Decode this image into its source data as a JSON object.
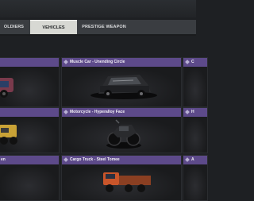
{
  "tabs": [
    {
      "label": "OLDIERS"
    },
    {
      "label": "VEHICLES"
    },
    {
      "label": "PRESTIGE WEAPON"
    }
  ],
  "cards": {
    "r1c1": {
      "title": ""
    },
    "r1c2": {
      "title": "Muscle Car - Unending Circle"
    },
    "r1c3": {
      "title": "C"
    },
    "r2c1": {
      "title": ""
    },
    "r2c2": {
      "title": "Motorcycle - Hyperalloy Face"
    },
    "r2c3": {
      "title": "H"
    },
    "r3c1": {
      "title": "en"
    },
    "r3c2": {
      "title": "Cargo Truck - Steel Tomee"
    },
    "r3c3": {
      "title": "A"
    }
  },
  "colors": {
    "header": "#5d4a8a",
    "active_tab": "#d7d8d3",
    "background": "#1e2023"
  }
}
